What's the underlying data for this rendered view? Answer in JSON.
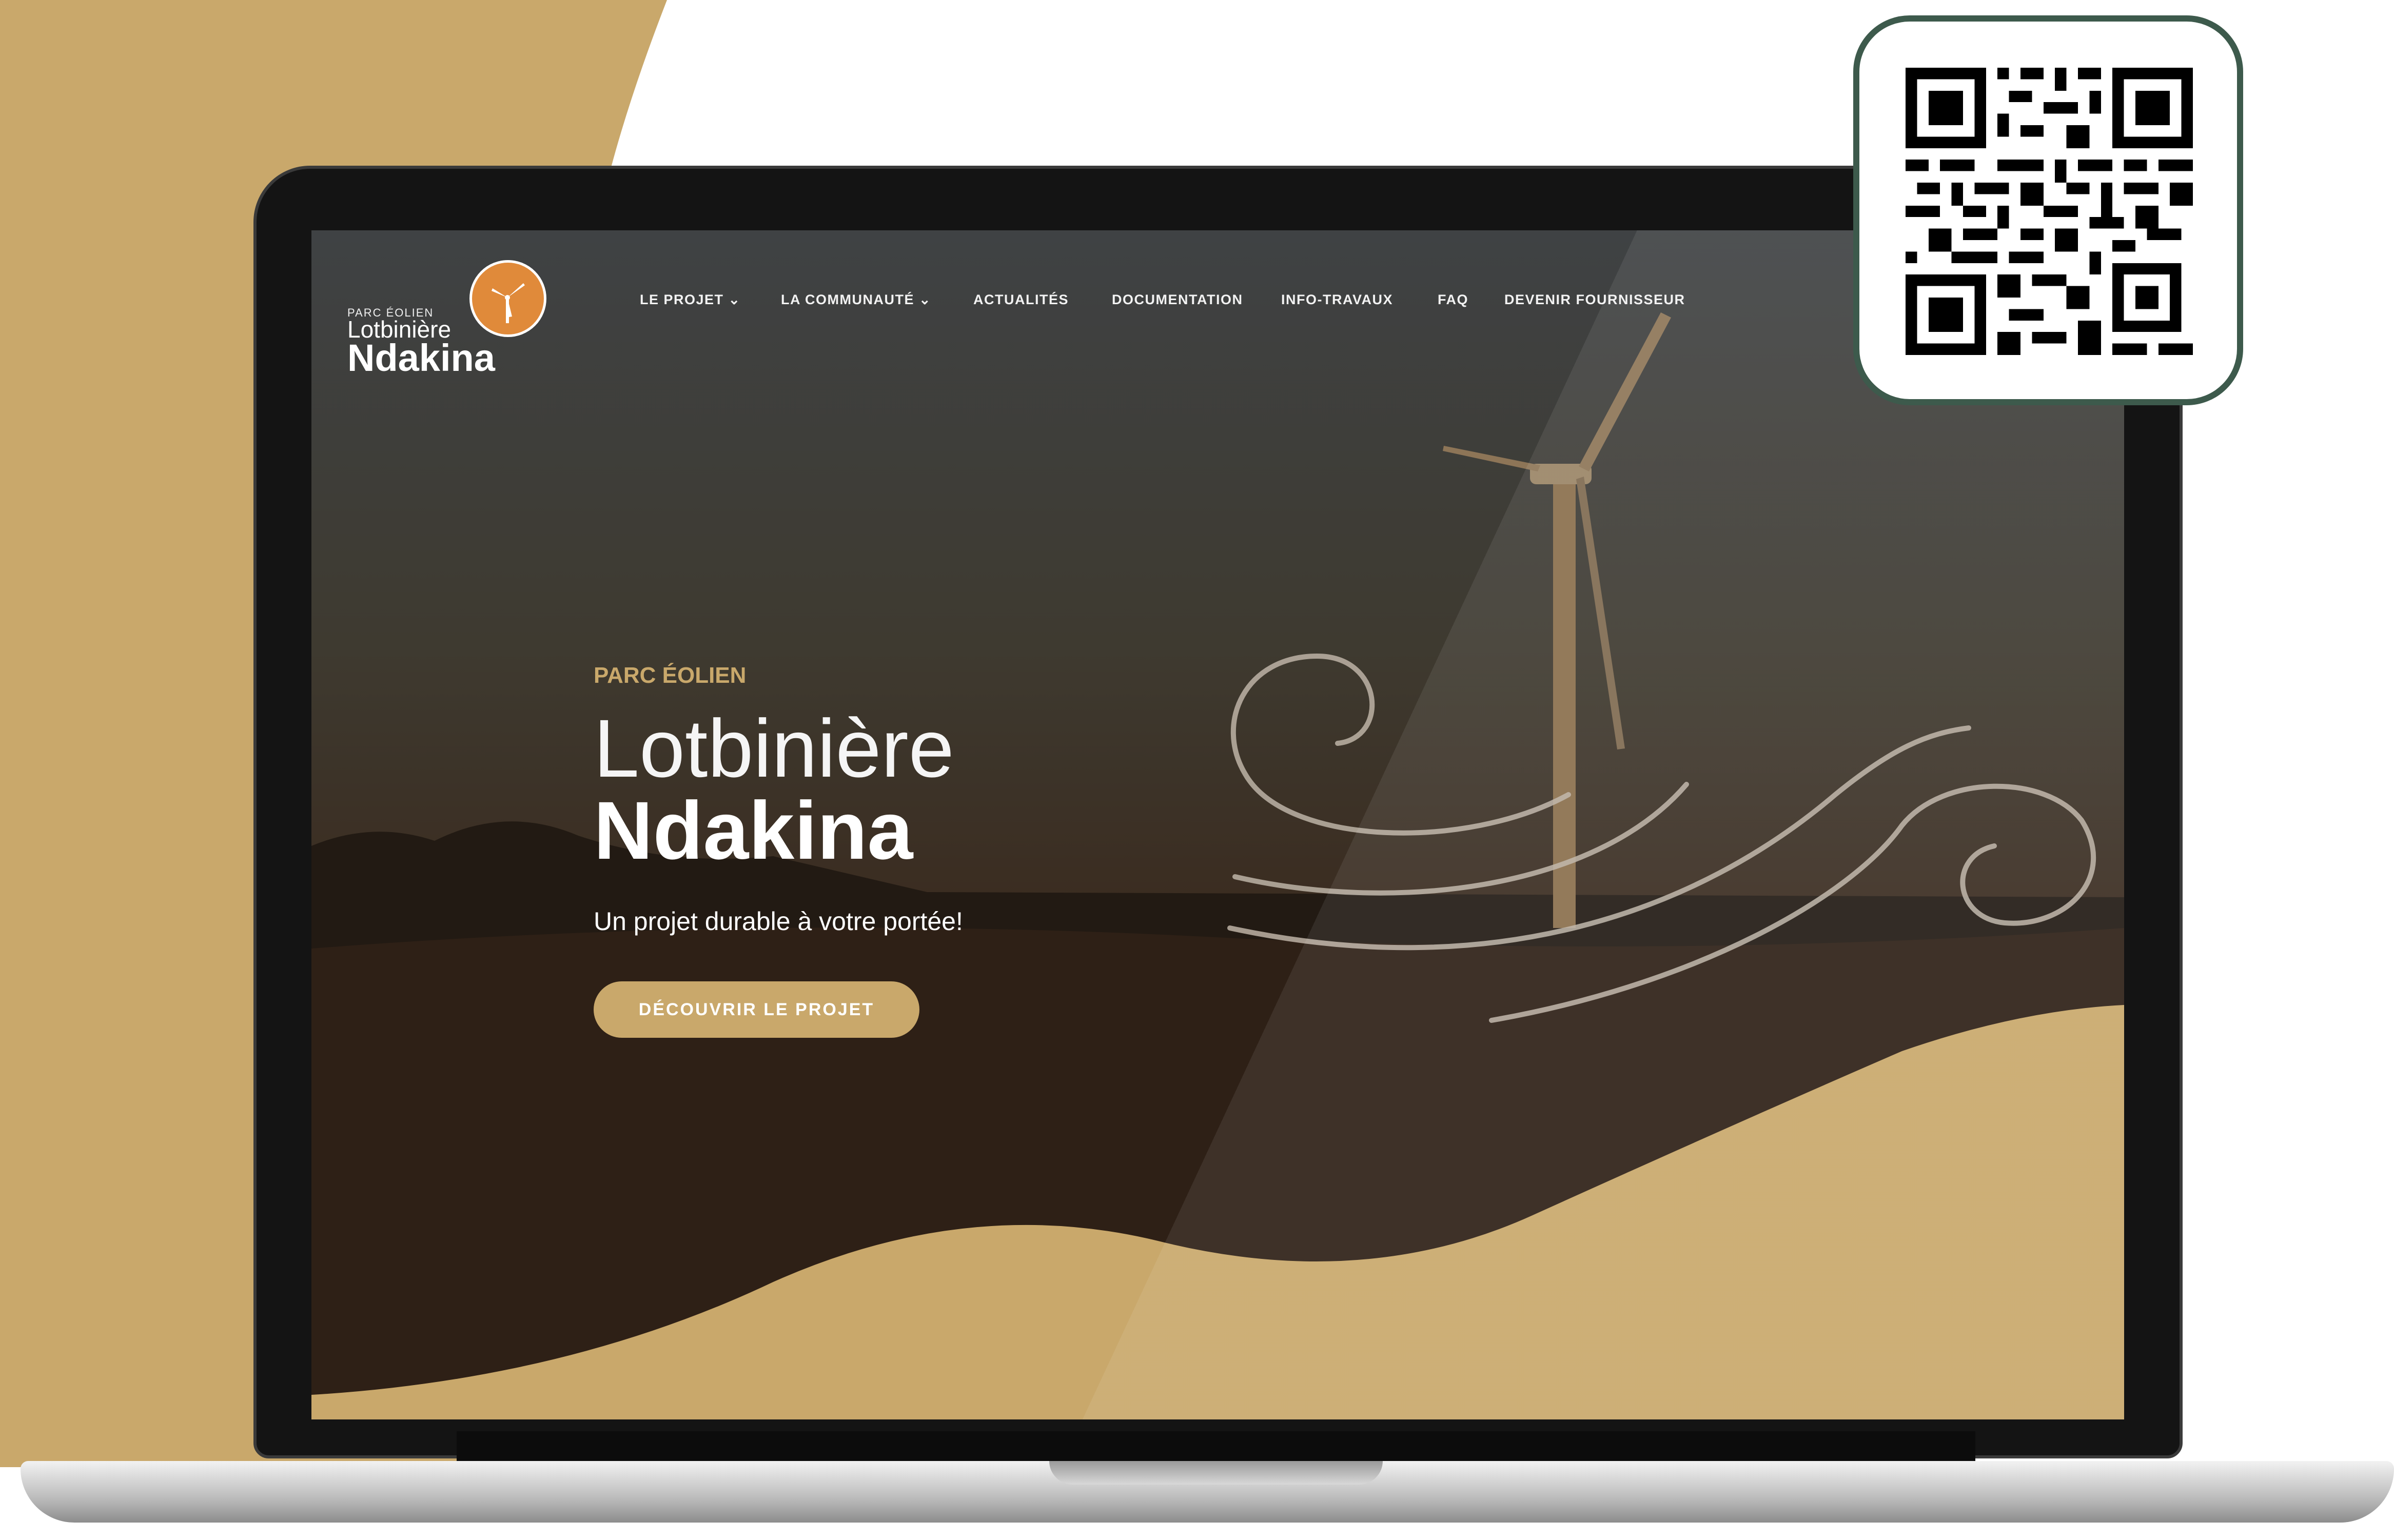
{
  "colors": {
    "accent_gold": "#c9a86b",
    "qr_border": "#3d5a4c",
    "logo_orange": "#e08a3a"
  },
  "site": {
    "logo": {
      "small": "PARC ÉOLIEN",
      "line1": "Lotbinière",
      "line2": "Ndakina",
      "badge_icon": "wind-turbine-icon"
    },
    "nav": {
      "items": [
        {
          "label": "LE PROJET",
          "has_dropdown": true
        },
        {
          "label": "LA COMMUNAUTÉ",
          "has_dropdown": true
        },
        {
          "label": "ACTUALITÉS",
          "has_dropdown": false
        },
        {
          "label": "DOCUMENTATION",
          "has_dropdown": false
        },
        {
          "label": "INFO-TRAVAUX",
          "has_dropdown": false
        },
        {
          "label": "FAQ",
          "has_dropdown": false
        },
        {
          "label": "DEVENIR FOURNISSEUR",
          "has_dropdown": false
        }
      ]
    },
    "hero": {
      "eyebrow": "PARC ÉOLIEN",
      "title_line1": "Lotbinière",
      "title_line2": "Ndakina",
      "tagline": "Un projet durable à votre portée!",
      "cta_label": "DÉCOUVRIR LE PROJET"
    }
  },
  "qr_code": {
    "icon": "qr-code-icon"
  }
}
